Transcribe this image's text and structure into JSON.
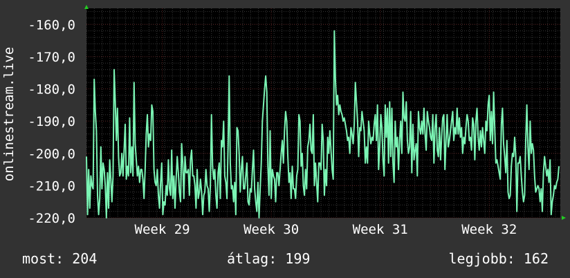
{
  "colors": {
    "background": "#323232",
    "plot_background": "#000000",
    "line": "#7bf4b4",
    "grid_major": "#5a2020",
    "grid_minor": "#3a3a3a",
    "arrow": "#22cc22"
  },
  "stats": {
    "current": "most: 204",
    "average": "átlag: 199",
    "best": "legjobb: 162"
  },
  "chart_data": {
    "type": "line",
    "ylabel": "onlinestream.live",
    "ylim": [
      -220,
      -155
    ],
    "yticks": [
      -160,
      -170,
      -180,
      -190,
      -200,
      -210,
      -220
    ],
    "ytick_labels": [
      "-160,0",
      "-170,0",
      "-180,0",
      "-190,0",
      "-200,0",
      "-210,0",
      "-220,0"
    ],
    "xticks": [
      "Week 29",
      "Week 30",
      "Week 31",
      "Week 32"
    ],
    "xtick_positions": [
      0.16,
      0.39,
      0.62,
      0.85
    ],
    "grid": true,
    "series": [
      {
        "values": [
          -201,
          -219,
          -205,
          -217,
          -207,
          -210,
          -211,
          -177,
          -187,
          -193,
          -213,
          -219,
          -214,
          -198,
          -211,
          -203,
          -205,
          -210,
          -220,
          -206,
          -217,
          -202,
          -208,
          -215,
          -207,
          -174,
          -184,
          -196,
          -186,
          -201,
          -207,
          -206,
          -200,
          -207,
          -199,
          -191,
          -208,
          -204,
          -207,
          -189,
          -206,
          -198,
          -207,
          -178,
          -197,
          -202,
          -207,
          -204,
          -209,
          -205,
          -205,
          -208,
          -214,
          -205,
          -194,
          -188,
          -198,
          -194,
          -196,
          -185,
          -187,
          -205,
          -209,
          -210,
          -205,
          -213,
          -217,
          -209,
          -203,
          -219,
          -215,
          -216,
          -210,
          -213,
          -202,
          -211,
          -213,
          -199,
          -214,
          -207,
          -217,
          -208,
          -201,
          -206,
          -212,
          -215,
          -197,
          -203,
          -214,
          -201,
          -206,
          -206,
          -205,
          -213,
          -202,
          -199,
          -207,
          -207,
          -210,
          -217,
          -205,
          -214,
          -212,
          -208,
          -212,
          -219,
          -213,
          -212,
          -205,
          -210,
          -211,
          -218,
          -210,
          -188,
          -204,
          -208,
          -205,
          -213,
          -217,
          -206,
          -203,
          -214,
          -196,
          -198,
          -190,
          -207,
          -209,
          -214,
          -198,
          -176,
          -203,
          -211,
          -210,
          -215,
          -209,
          -219,
          -192,
          -193,
          -200,
          -212,
          -205,
          -201,
          -211,
          -211,
          -207,
          -203,
          -215,
          -216,
          -211,
          -212,
          -205,
          -199,
          -211,
          -215,
          -218,
          -209,
          -221,
          -211,
          -203,
          -190,
          -185,
          -180,
          -176,
          -181,
          -204,
          -213,
          -193,
          -214,
          -205,
          -207,
          -208,
          -215,
          -206,
          -206,
          -210,
          -205,
          -200,
          -196,
          -203,
          -193,
          -187,
          -190,
          -201,
          -209,
          -206,
          -214,
          -204,
          -211,
          -211,
          -214,
          -207,
          -205,
          -188,
          -190,
          -204,
          -200,
          -210,
          -213,
          -205,
          -211,
          -198,
          -196,
          -191,
          -199,
          -200,
          -188,
          -210,
          -203,
          -209,
          -215,
          -203,
          -203,
          -205,
          -191,
          -196,
          -213,
          -205,
          -210,
          -195,
          -200,
          -193,
          -199,
          -205,
          -208,
          -162,
          -177,
          -185,
          -182,
          -188,
          -185,
          -187,
          -188,
          -190,
          -189,
          -191,
          -193,
          -196,
          -195,
          -200,
          -192,
          -194,
          -197,
          -191,
          -178,
          -184,
          -190,
          -201,
          -192,
          -193,
          -187,
          -190,
          -193,
          -203,
          -198,
          -203,
          -190,
          -194,
          -197,
          -195,
          -196,
          -191,
          -188,
          -196,
          -185,
          -205,
          -198,
          -188,
          -192,
          -202,
          -207,
          -185,
          -195,
          -186,
          -203,
          -184,
          -201,
          -186,
          -203,
          -209,
          -190,
          -198,
          -195,
          -205,
          -196,
          -190,
          -200,
          -181,
          -189,
          -190,
          -184,
          -196,
          -200,
          -198,
          -187,
          -206,
          -191,
          -202,
          -199,
          -197,
          -207,
          -187,
          -192,
          -194,
          -190,
          -194,
          -186,
          -194,
          -199,
          -187,
          -190,
          -192,
          -195,
          -196,
          -188,
          -203,
          -192,
          -188,
          -199,
          -201,
          -192,
          -202,
          -195,
          -189,
          -188,
          -205,
          -196,
          -188,
          -198,
          -196,
          -193,
          -190,
          -187,
          -196,
          -192,
          -194,
          -186,
          -194,
          -189,
          -195,
          -192,
          -200,
          -195,
          -197,
          -192,
          -188,
          -190,
          -196,
          -195,
          -199,
          -189,
          -191,
          -202,
          -190,
          -186,
          -195,
          -199,
          -193,
          -198,
          -192,
          -196,
          -200,
          -190,
          -193,
          -185,
          -182,
          -196,
          -187,
          -197,
          -181,
          -192,
          -203,
          -202,
          -204,
          -206,
          -208,
          -191,
          -186,
          -197,
          -201,
          -206,
          -196,
          -212,
          -214,
          -213,
          -204,
          -200,
          -201,
          -195,
          -201,
          -218,
          -203,
          -203,
          -201,
          -207,
          -212,
          -215,
          -213,
          -196,
          -185,
          -198,
          -205,
          -190,
          -200,
          -197,
          -199,
          -207,
          -212,
          -211,
          -210,
          -211,
          -215,
          -211,
          -218,
          -206,
          -201,
          -204,
          -207,
          -205,
          -209,
          -202,
          -219,
          -215,
          -213,
          -210,
          -211,
          -209,
          -208,
          -204
        ]
      }
    ]
  }
}
